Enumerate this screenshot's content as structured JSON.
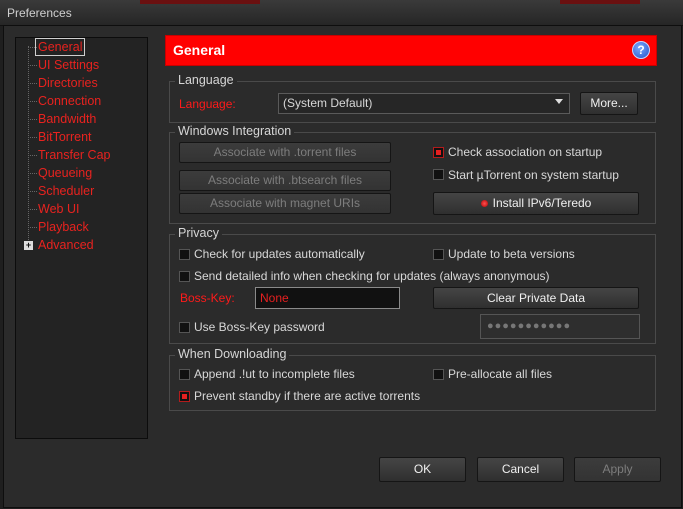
{
  "window": {
    "title": "Preferences"
  },
  "sidebar": {
    "items": [
      {
        "label": "General",
        "selected": true
      },
      {
        "label": "UI Settings"
      },
      {
        "label": "Directories"
      },
      {
        "label": "Connection"
      },
      {
        "label": "Bandwidth"
      },
      {
        "label": "BitTorrent"
      },
      {
        "label": "Transfer Cap"
      },
      {
        "label": "Queueing"
      },
      {
        "label": "Scheduler"
      },
      {
        "label": "Web UI"
      },
      {
        "label": "Playback"
      },
      {
        "label": "Advanced",
        "expandable": true,
        "expander": "+"
      }
    ]
  },
  "header": {
    "title": "General",
    "help_icon": "?"
  },
  "language": {
    "group_label": "Language",
    "label": "Language:",
    "value": "(System Default)",
    "more_button": "More..."
  },
  "windows_integration": {
    "group_label": "Windows Integration",
    "assoc_torrent": "Associate with .torrent files",
    "assoc_btsearch": "Associate with .btsearch files",
    "assoc_magnet": "Associate with magnet URIs",
    "check_assoc_label": "Check association on startup",
    "check_assoc_checked": true,
    "start_on_startup_label": "Start µTorrent on system startup",
    "start_on_startup_checked": false,
    "install_ipv6": "Install IPv6/Teredo"
  },
  "privacy": {
    "group_label": "Privacy",
    "check_updates_label": "Check for updates automatically",
    "beta_label": "Update to beta versions",
    "send_info_label": "Send detailed info when checking for updates (always anonymous)",
    "boss_key_label": "Boss-Key:",
    "boss_key_value": "None",
    "clear_private": "Clear Private Data",
    "use_boss_pw_label": "Use Boss-Key password",
    "password_mask": "●●●●●●●●●●●"
  },
  "downloading": {
    "group_label": "When Downloading",
    "append_label": "Append .!ut to incomplete files",
    "preallocate_label": "Pre-allocate all files",
    "prevent_standby_label": "Prevent standby if there are active torrents",
    "prevent_standby_checked": true
  },
  "footer": {
    "ok": "OK",
    "cancel": "Cancel",
    "apply": "Apply"
  }
}
